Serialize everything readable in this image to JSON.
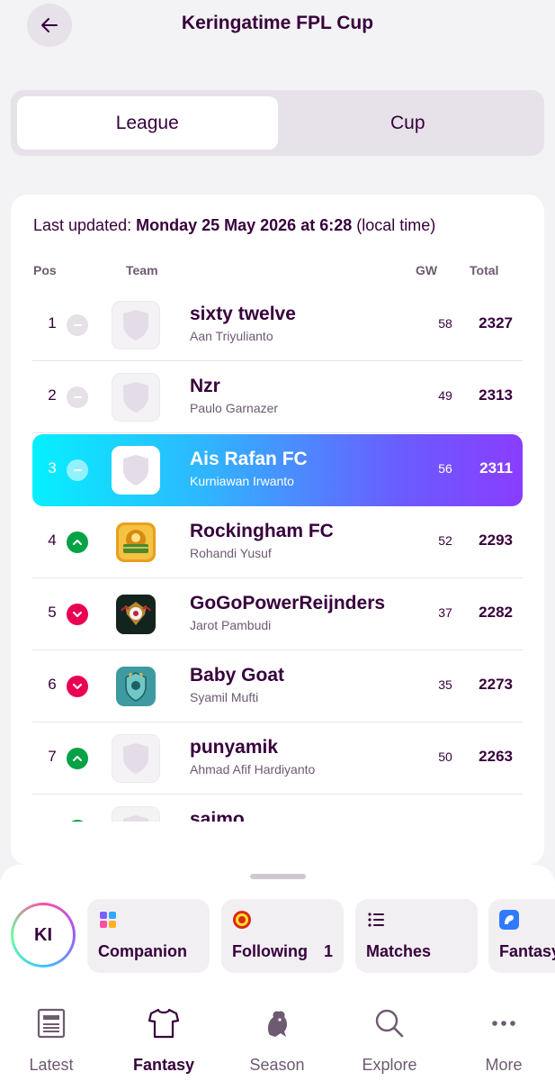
{
  "header": {
    "title": "Keringatime FPL Cup",
    "back_icon": "arrow-left-icon"
  },
  "tabs": [
    {
      "label": "League",
      "active": true
    },
    {
      "label": "Cup",
      "active": false
    }
  ],
  "standings": {
    "updated_prefix": "Last updated:",
    "updated_value": "Monday 25 May 2026 at 6:28",
    "updated_suffix": "(local time)",
    "columns": {
      "pos": "Pos",
      "team": "Team",
      "gw": "GW",
      "total": "Total"
    },
    "rows": [
      {
        "pos": "1",
        "movement": "same",
        "team": "sixty twelve",
        "manager": "Aan Triyulianto",
        "gw": "58",
        "total": "2327",
        "crest": "default-shield"
      },
      {
        "pos": "2",
        "movement": "same",
        "team": "Nzr",
        "manager": "Paulo Garnazer",
        "gw": "49",
        "total": "2313",
        "crest": "default-shield"
      },
      {
        "pos": "3",
        "movement": "same",
        "team": "Ais Rafan FC",
        "manager": "Kurniawan Irwanto",
        "gw": "56",
        "total": "2311",
        "crest": "default-shield",
        "highlighted": true
      },
      {
        "pos": "4",
        "movement": "up",
        "team": "Rockingham FC",
        "manager": "Rohandi Yusuf",
        "gw": "52",
        "total": "2293",
        "crest": "golden-field-crest"
      },
      {
        "pos": "5",
        "movement": "down",
        "team": "GoGoPowerReijnders",
        "manager": "Jarot Pambudi",
        "gw": "37",
        "total": "2282",
        "crest": "winged-ball-crest"
      },
      {
        "pos": "6",
        "movement": "down",
        "team": "Baby Goat",
        "manager": "Syamil Mufti",
        "gw": "35",
        "total": "2273",
        "crest": "teal-goat-crest"
      },
      {
        "pos": "7",
        "movement": "up",
        "team": "punyamik",
        "manager": "Ahmad Afif Hardiyanto",
        "gw": "50",
        "total": "2263",
        "crest": "default-shield"
      },
      {
        "pos": "",
        "movement": "up",
        "team": "saimo",
        "manager": "",
        "gw": "",
        "total": "",
        "crest": "default-shield",
        "partial": true
      }
    ]
  },
  "quick_bar": {
    "avatar_initials": "KI",
    "chips": [
      {
        "label": "Companion",
        "icon": "copilot-icon"
      },
      {
        "label": "Following",
        "badge": "1",
        "icon": "man-utd-crest-icon"
      },
      {
        "label": "Matches",
        "icon": "list-icon"
      },
      {
        "label": "Fantasy",
        "icon": "premier-league-app-icon"
      }
    ]
  },
  "bottom_nav": [
    {
      "label": "Latest",
      "icon": "news-icon",
      "active": false
    },
    {
      "label": "Fantasy",
      "icon": "shirt-icon",
      "active": true
    },
    {
      "label": "Season",
      "icon": "lion-icon",
      "active": false
    },
    {
      "label": "Explore",
      "icon": "search-icon",
      "active": false
    },
    {
      "label": "More",
      "icon": "more-icon",
      "active": false
    }
  ],
  "colors": {
    "primary": "#37003c",
    "up": "#05a245",
    "down": "#e90052",
    "highlight_start": "#05f0ff",
    "highlight_end": "#8a3dff"
  }
}
